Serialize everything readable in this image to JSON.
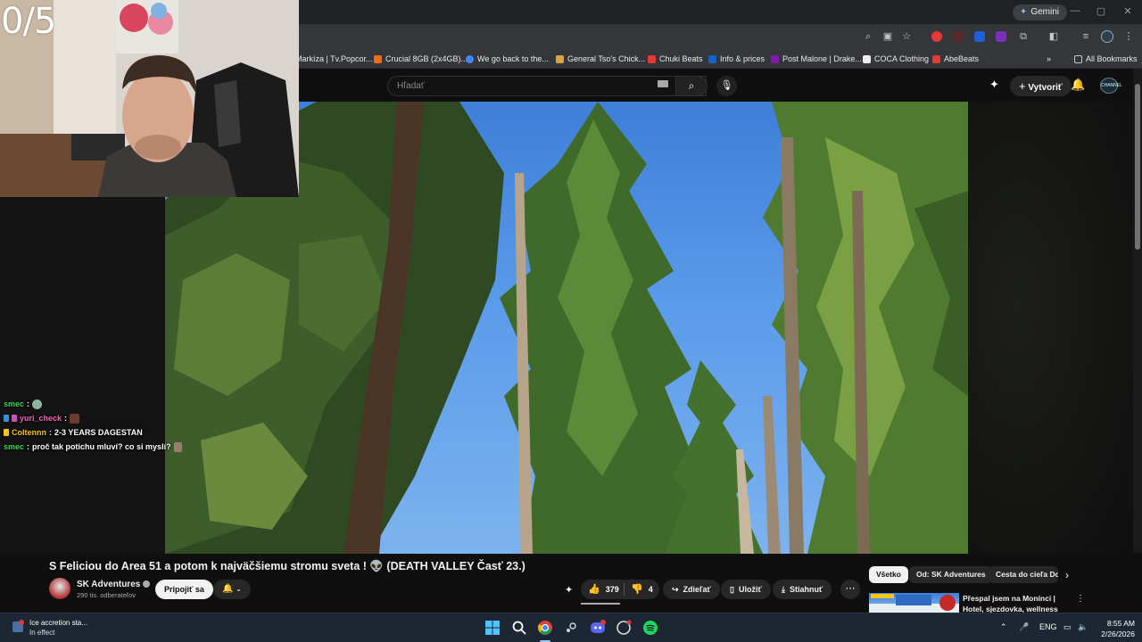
{
  "overlay": {
    "counter": "0/5"
  },
  "browser": {
    "gemini_label": "Gemini",
    "bookmarks": [
      {
        "label": "Markíza | Tv.Popcor...",
        "color": "#9aa0a6"
      },
      {
        "label": "Crucial 8GB (2x4GB)...",
        "color": "#f26b1d"
      },
      {
        "label": "We go back to the...",
        "color": "#4285f4"
      },
      {
        "label": "General Tso's Chick...",
        "color": "#d9a441"
      },
      {
        "label": "Chuki Beats",
        "color": "#e53935"
      },
      {
        "label": "Info & prices",
        "color": "#1565c0"
      },
      {
        "label": "Post Malone | Drake...",
        "color": "#7b1fa2"
      },
      {
        "label": "COCA Clothing",
        "color": "#eeeeee"
      },
      {
        "label": "AbeBeats",
        "color": "#e53935"
      }
    ],
    "all_bookmarks_label": "All Bookmarks"
  },
  "masthead": {
    "search_placeholder": "Hľadať",
    "create_label": "Vytvoriť",
    "avatar_text": "CHANNEL"
  },
  "chat": [
    {
      "user": "smec",
      "message": "",
      "user_color": "green",
      "emote": "#8fb3a0"
    },
    {
      "user": "yuri_check",
      "message": "",
      "user_color": "pink",
      "emote": "#6b3b2f"
    },
    {
      "user": "Coltennn",
      "message": "2-3 YEARS DAGESTAN",
      "user_color": "yellow",
      "emote": ""
    },
    {
      "user": "smec",
      "message": "proč tak potichu mluví? co si myslí?",
      "user_color": "green",
      "emote": "#9b7b6b"
    }
  ],
  "video_info": {
    "title": "S Feliciou do Area 51 a potom k najväčšiemu stromu sveta ! 👽 (DEATH VALLEY Časť 23.)",
    "channel_name": "SK Adventures",
    "subscribers": "290 tis. odberateľov",
    "join_label": "Pripojiť sa",
    "likes": "379",
    "dislikes": "4",
    "share_label": "Zdieľať",
    "save_label": "Uložiť",
    "download_label": "Stiahnuť"
  },
  "chips": [
    {
      "label": "Všetko",
      "active": true
    },
    {
      "label": "Od: SK Adventures",
      "active": false
    },
    {
      "label": "Cesta do cieľa Do",
      "active": false
    }
  ],
  "recommendation": {
    "title": "Přespal jsem na Monínci | Hotel, sjezdovka, wellness"
  },
  "taskbar": {
    "notification_title": "Ice accretion sta...",
    "notification_sub": "In effect",
    "language": "ENG",
    "time": "8:55 AM",
    "date": "2/26/2026"
  }
}
